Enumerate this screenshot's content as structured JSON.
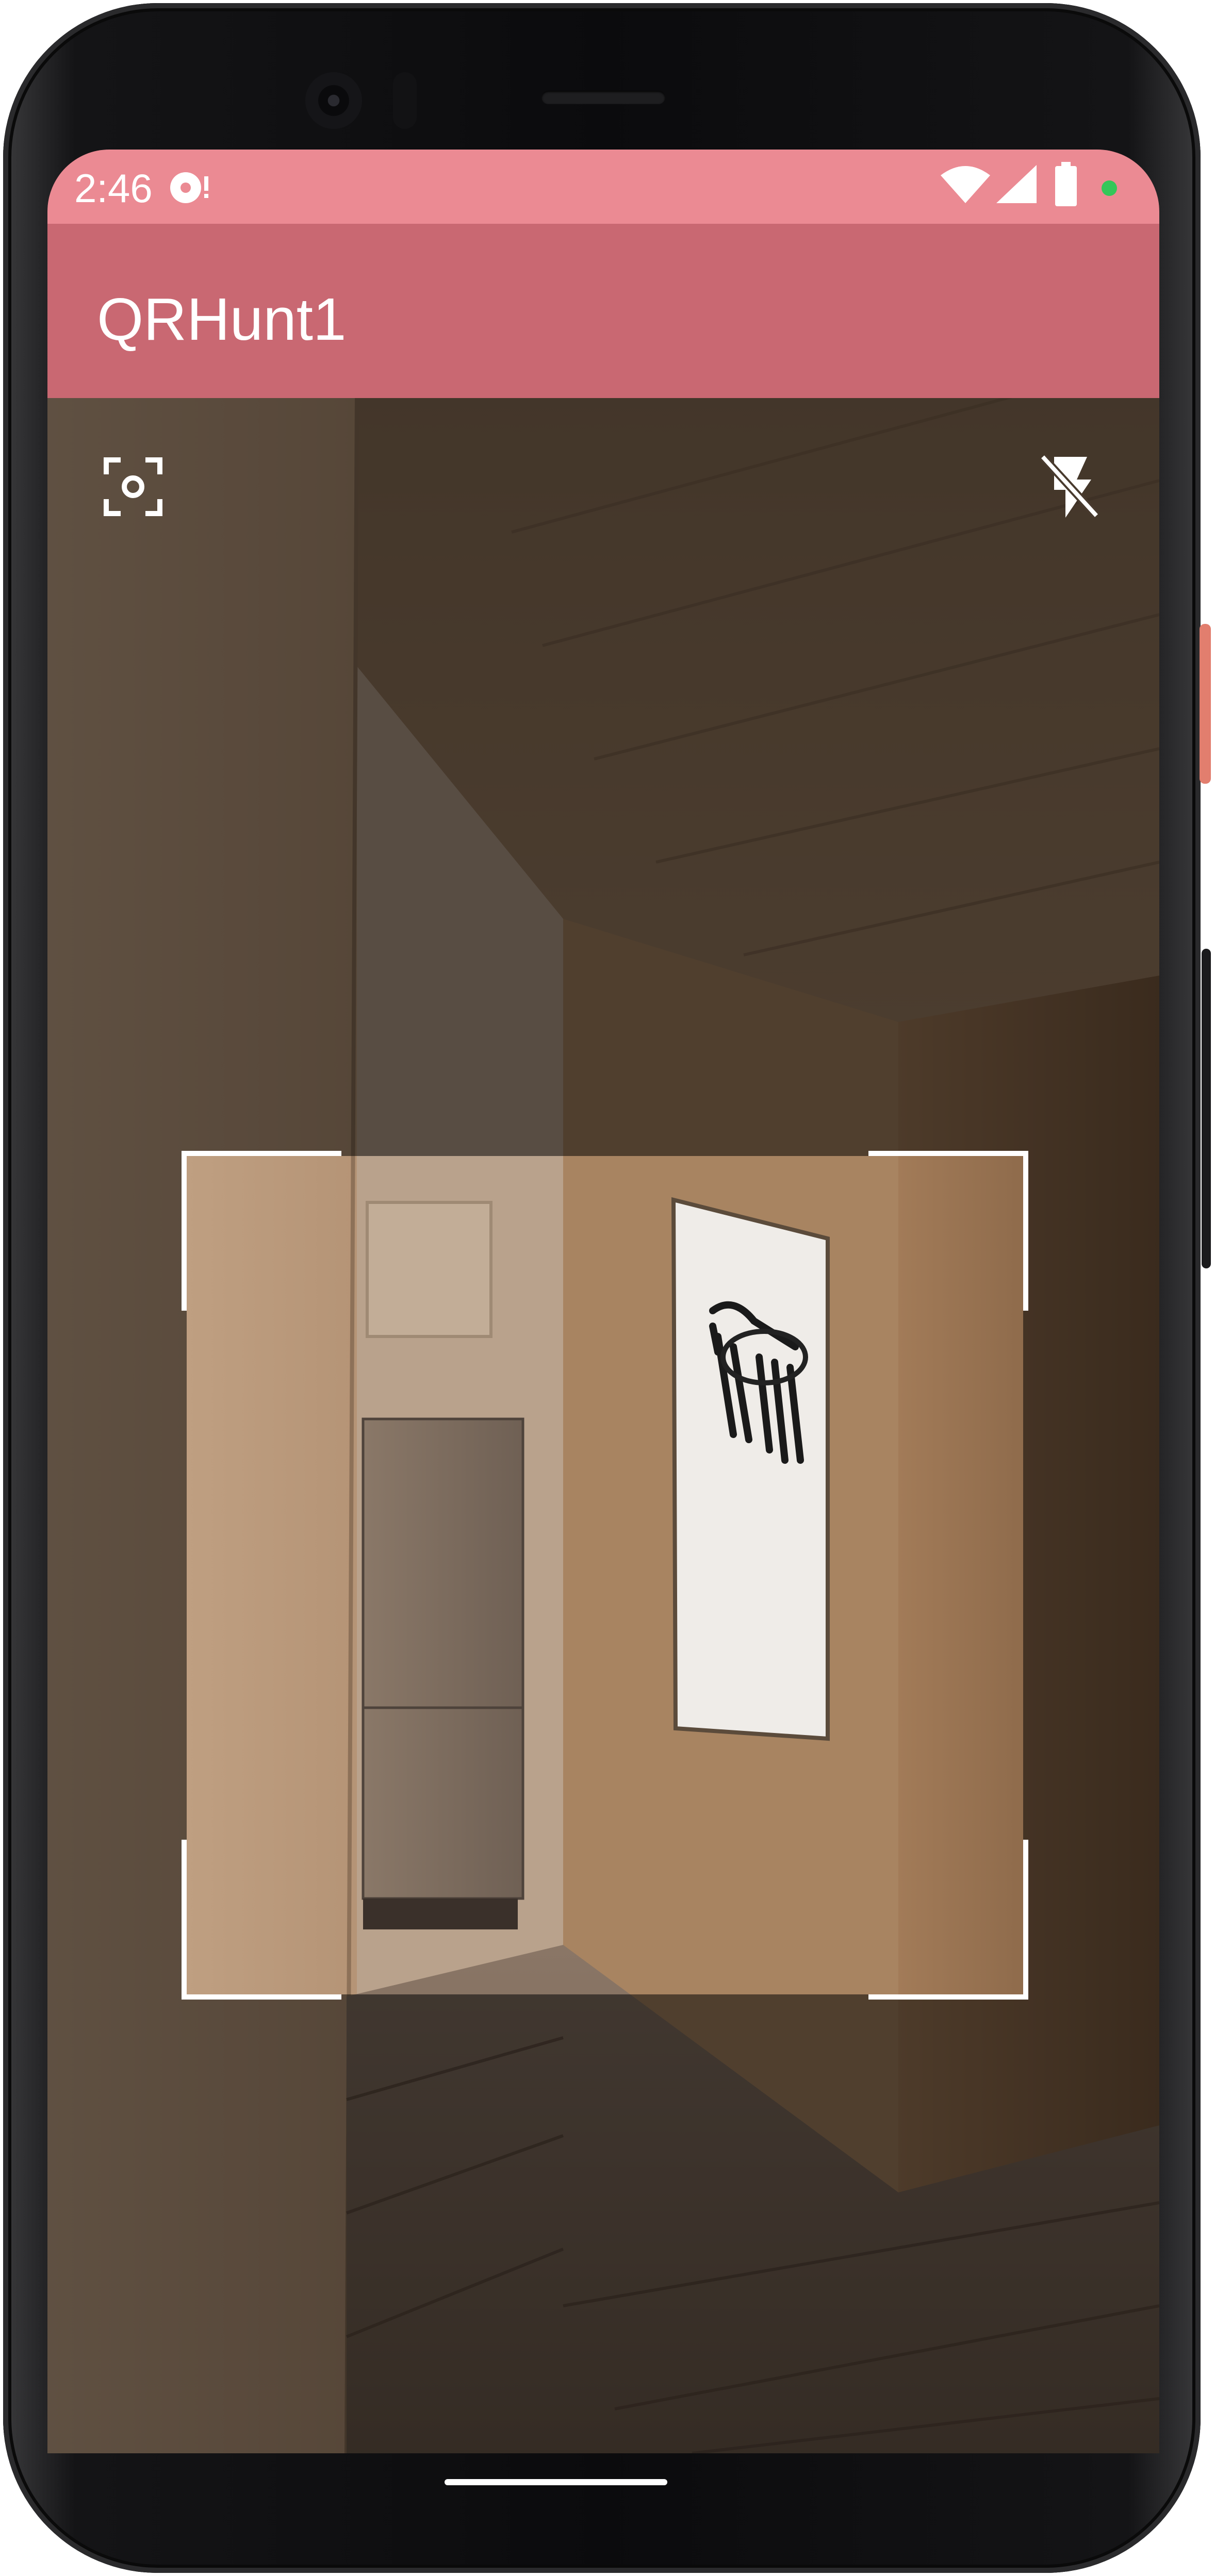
{
  "status_bar": {
    "time": "2:46",
    "icons": [
      "notification-badge-icon",
      "wifi-icon",
      "signal-icon",
      "battery-icon",
      "privacy-dot-icon"
    ],
    "background": "#eb8a93"
  },
  "app_bar": {
    "title": "QRHunt1",
    "background": "#c96872"
  },
  "scanner": {
    "left_action_icon": "focus-camera-icon",
    "right_action_icon": "flash-off-icon",
    "frame_color": "#ffffff"
  },
  "colors": {
    "accent": "#c96872",
    "status": "#eb8a93",
    "power_button": "#e27e6e",
    "privacy_dot": "#34c759"
  }
}
